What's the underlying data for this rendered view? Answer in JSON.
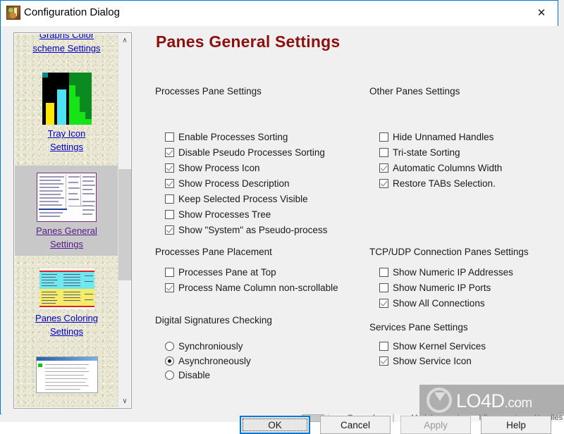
{
  "window": {
    "title": "Configuration Dialog",
    "icon": "app-icon",
    "close_label": "✕"
  },
  "sidebar": {
    "scroll_up_glyph": "∧",
    "scroll_down_glyph": "∨",
    "items": [
      {
        "label_line1": "Graphs Color",
        "label_line2": "scheme Settings",
        "selected": false,
        "thumb": "graphs-color-thumb"
      },
      {
        "label_line1": "Tray Icon",
        "label_line2": "Settings",
        "selected": false,
        "thumb": "tray-icon-thumb"
      },
      {
        "label_line1": "Panes General",
        "label_line2": "Settings",
        "selected": true,
        "thumb": "panes-general-thumb"
      },
      {
        "label_line1": "Panes Coloring",
        "label_line2": "Settings",
        "selected": false,
        "thumb": "panes-coloring-thumb"
      }
    ]
  },
  "page": {
    "title": "Panes General Settings"
  },
  "groups": {
    "processes_pane_settings": {
      "label": "Processes Pane Settings",
      "options": [
        {
          "label": "Enable Processes Sorting",
          "checked": false
        },
        {
          "label": "Disable Pseudo Processes Sorting",
          "checked": true
        },
        {
          "label": "Show Process Icon",
          "checked": true
        },
        {
          "label": "Show Process Description",
          "checked": true
        },
        {
          "label": "Keep Selected Process Visible",
          "checked": false
        },
        {
          "label": "Show Processes Tree",
          "checked": false
        },
        {
          "label": "Show \"System\" as Pseudo-process",
          "checked": true
        }
      ]
    },
    "processes_pane_placement": {
      "label": "Processes Pane Placement",
      "options": [
        {
          "label": "Processes Pane at Top",
          "checked": false
        },
        {
          "label": "Process Name Column non-scrollable",
          "checked": true
        }
      ]
    },
    "digital_signatures_checking": {
      "label": "Digital Signatures Checking",
      "options": [
        {
          "label": "Synchroniously",
          "selected": false
        },
        {
          "label": "Asynchroneously",
          "selected": true
        },
        {
          "label": "Disable",
          "selected": false
        }
      ]
    },
    "other_panes_settings": {
      "label": "Other Panes Settings",
      "options": [
        {
          "label": "Hide Unnamed Handles",
          "checked": false
        },
        {
          "label": "Tri-state Sorting",
          "checked": false
        },
        {
          "label": "Automatic Columns Width",
          "checked": true
        },
        {
          "label": "Restore TABs Selection.",
          "checked": true
        }
      ]
    },
    "tcp_udp_connection_panes_settings": {
      "label": "TCP/UDP Connection Panes Settings",
      "options": [
        {
          "label": "Show Numeric IP Addresses",
          "checked": false
        },
        {
          "label": "Show Numeric IP Ports",
          "checked": false
        },
        {
          "label": "Show All Connections",
          "checked": true
        }
      ]
    },
    "services_pane_settings": {
      "label": "Services Pane Settings",
      "options": [
        {
          "label": "Show Kernel Services",
          "checked": false
        },
        {
          "label": "Show Service Icon",
          "checked": true
        }
      ]
    }
  },
  "buttons": {
    "ok": "OK",
    "cancel": "Cancel",
    "apply": "Apply",
    "help": "Help"
  },
  "background_window": {
    "tabs": [
      "General",
      "Modules",
      "Idles",
      "Handles"
    ],
    "caret_glyph": "›",
    "arrow_glyph": "↓"
  },
  "watermark": {
    "text": "LO4D",
    "suffix": ".com"
  },
  "colors": {
    "accent": "#0078d7",
    "title_red": "#8c1010",
    "link": "#0000cc",
    "link_visited": "#551a8b",
    "selection": "#c8c8c8",
    "dialog_bg": "#f0f0f0",
    "list_bg": "#e9e7d2"
  }
}
